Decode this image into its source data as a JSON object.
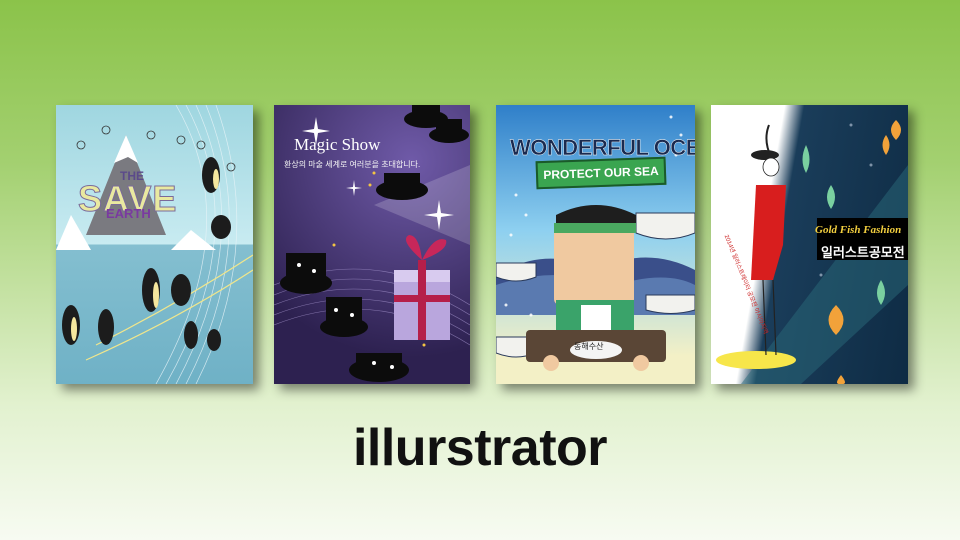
{
  "caption": "illurstrator",
  "cards": {
    "save_earth": {
      "line1": "THE",
      "line2": "SAVE",
      "line3": "EARTH"
    },
    "magic_show": {
      "title": "Magic Show",
      "subtitle": "환상의 마술 세계로 여러분을 초대합니다."
    },
    "ocean": {
      "title": "WONDERFUL OCEAN",
      "banner": "PROTECT OUR SEA",
      "sign": "동해수산"
    },
    "gold_fish": {
      "title": "Gold Fish Fashion",
      "subtitle": "일러스트공모전",
      "vertical": "2014년 일러스트레이터 공모전 아시아지역"
    }
  }
}
